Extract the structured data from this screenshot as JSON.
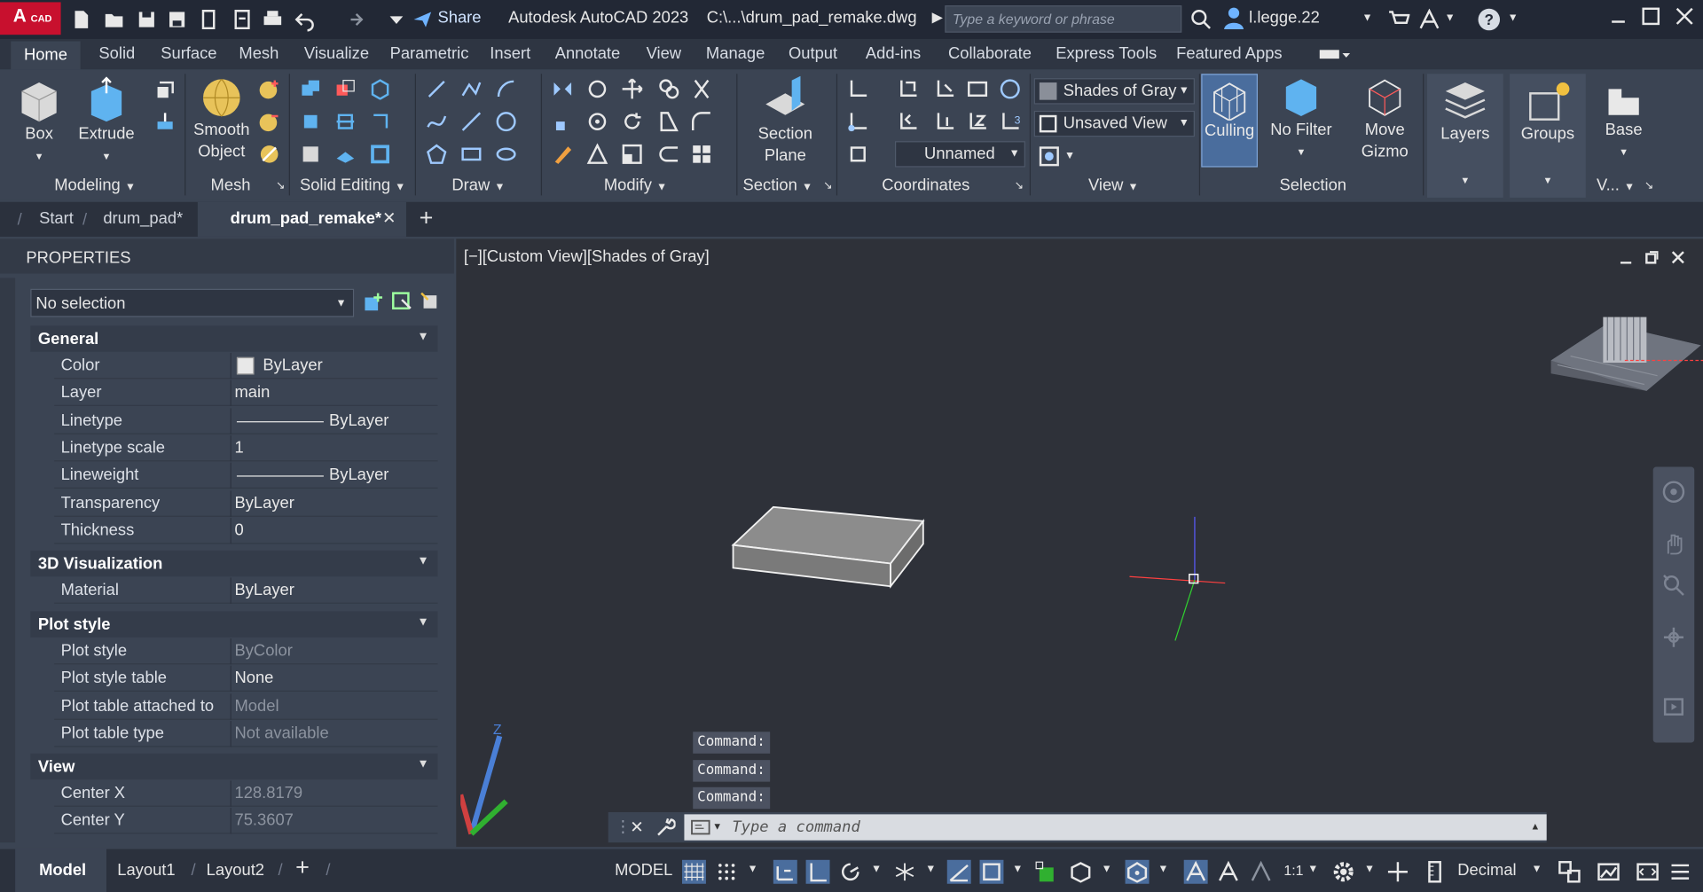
{
  "titlebar": {
    "app_badge": "A",
    "app_badge_sub": "CAD",
    "share_label": "Share",
    "app_name": "Autodesk AutoCAD 2023",
    "file_path": "C:\\...\\drum_pad_remake.dwg",
    "search_placeholder": "Type a keyword or phrase",
    "user": "l.legge.22"
  },
  "ribbon_tabs": [
    "Home",
    "Solid",
    "Surface",
    "Mesh",
    "Visualize",
    "Parametric",
    "Insert",
    "Annotate",
    "View",
    "Manage",
    "Output",
    "Add-ins",
    "Collaborate",
    "Express Tools",
    "Featured Apps"
  ],
  "ribbon": {
    "box": "Box",
    "extrude": "Extrude",
    "smooth_object_1": "Smooth",
    "smooth_object_2": "Object",
    "section_plane_1": "Section",
    "section_plane_2": "Plane",
    "visual_style": "Shades of Gray",
    "named_view": "Unsaved View",
    "ucs_name": "Unnamed",
    "culling": "Culling",
    "no_filter": "No Filter",
    "move_gizmo_1": "Move",
    "move_gizmo_2": "Gizmo",
    "layers": "Layers",
    "groups": "Groups",
    "base": "Base",
    "panels": {
      "modeling": "Modeling",
      "mesh": "Mesh",
      "solid_editing": "Solid Editing",
      "draw": "Draw",
      "modify": "Modify",
      "section": "Section",
      "coordinates": "Coordinates",
      "view": "View",
      "selection": "Selection",
      "v": "V..."
    }
  },
  "doc_tabs": {
    "start": "Start",
    "tab1": "drum_pad*",
    "tab2": "drum_pad_remake*"
  },
  "properties": {
    "title": "PROPERTIES",
    "selection": "No selection",
    "general": {
      "header": "General",
      "rows": [
        {
          "key": "Color",
          "value": "ByLayer"
        },
        {
          "key": "Layer",
          "value": "main"
        },
        {
          "key": "Linetype",
          "value": "ByLayer"
        },
        {
          "key": "Linetype scale",
          "value": "1"
        },
        {
          "key": "Lineweight",
          "value": "ByLayer"
        },
        {
          "key": "Transparency",
          "value": "ByLayer"
        },
        {
          "key": "Thickness",
          "value": "0"
        }
      ]
    },
    "visualization": {
      "header": "3D Visualization",
      "rows": [
        {
          "key": "Material",
          "value": "ByLayer"
        }
      ]
    },
    "plot_style": {
      "header": "Plot style",
      "rows": [
        {
          "key": "Plot style",
          "value": "ByColor"
        },
        {
          "key": "Plot style table",
          "value": "None"
        },
        {
          "key": "Plot table attached to",
          "value": "Model"
        },
        {
          "key": "Plot table type",
          "value": "Not available"
        }
      ]
    },
    "view": {
      "header": "View",
      "rows": [
        {
          "key": "Center X",
          "value": "128.8179"
        },
        {
          "key": "Center Y",
          "value": "75.3607"
        }
      ]
    }
  },
  "viewport": {
    "label": "[−][Custom View][Shades of Gray]"
  },
  "command": {
    "history": [
      "Command:",
      "Command:",
      "Command:"
    ],
    "placeholder": "Type  a  command"
  },
  "status": {
    "model_tab": "Model",
    "layout1": "Layout1",
    "layout2": "Layout2",
    "model_btn": "MODEL",
    "scale": "1:1",
    "units": "Decimal"
  },
  "colors": {
    "accent": "#4a6d9d",
    "brand": "#c8102e",
    "viewport_bg": "#2e3139"
  }
}
